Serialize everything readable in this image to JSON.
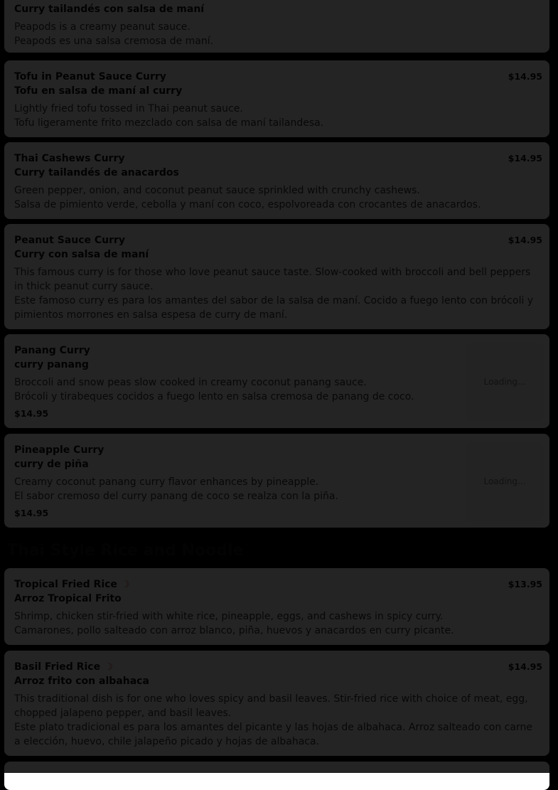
{
  "items": [
    {
      "name_es": "Curry tailandés con salsa de maní",
      "desc_en": "Peapods is a creamy peanut sauce.",
      "desc_es": "Peapods es una salsa cremosa de maní."
    },
    {
      "name_en": "Tofu in Peanut Sauce Curry",
      "name_es": "Tofu en salsa de maní al curry",
      "desc_en": "Lightly fried tofu tossed in Thai peanut sauce.",
      "desc_es": "Tofu ligeramente frito mezclado con salsa de maní tailandesa.",
      "price": "$14.95"
    },
    {
      "name_en": "Thai Cashews Curry",
      "name_es": "Curry tailandés de anacardos",
      "desc_en": "Green pepper, onion, and coconut peanut sauce sprinkled with crunchy cashews.",
      "desc_es": "Salsa de pimiento verde, cebolla y maní con coco, espolvoreada con crocantes de anacardos.",
      "price": "$14.95"
    },
    {
      "name_en": "Peanut Sauce Curry",
      "name_es": "Curry con salsa de maní",
      "desc_en": "This famous curry is for those who love peanut sauce taste. Slow-cooked with broccoli and bell peppers in thick peanut curry sauce.",
      "desc_es": "Este famoso curry es para los amantes del sabor de la salsa de maní. Cocido a fuego lento con brócoli y pimientos morrones en salsa espesa de curry de maní.",
      "price": "$14.95"
    },
    {
      "name_en": "Panang Curry",
      "name_es": "curry panang",
      "desc_en": "Broccoli and snow peas slow cooked in creamy coconut panang sauce.",
      "desc_es": "Brócoli y tirabeques cocidos a fuego lento en salsa cremosa de panang de coco.",
      "price": "$14.95",
      "image_status": "Loading..."
    },
    {
      "name_en": "Pineapple Curry",
      "name_es": "curry de piña",
      "desc_en": "Creamy coconut panang curry flavor enhances by pineapple.",
      "desc_es": "El sabor cremoso del curry panang de coco se realza con la piña.",
      "price": "$14.95",
      "image_status": "Loading..."
    },
    {
      "name_en": "Tropical Fried Rice",
      "name_es": "Arroz Tropical Frito",
      "desc_en": "Shrimp, chicken stir-fried with white rice, pineapple, eggs, and cashews in spicy curry.",
      "desc_es": "Camarones, pollo salteado con arroz blanco, piña, huevos y anacardos en curry picante.",
      "price": "$13.95",
      "spicy_icon": "chili-pepper-icon"
    },
    {
      "name_en": "Basil Fried Rice",
      "name_es": "Arroz frito con albahaca",
      "desc_en": "This traditional dish is for one who loves spicy and basil leaves. Stir-fried rice with choice of meat, egg, chopped jalapeno pepper, and basil leaves.",
      "desc_es": "Este plato tradicional es para los amantes del picante y las hojas de albahaca. Arroz salteado con carne a elección, huevo, chile jalapeño picado y hojas de albahaca.",
      "price": "$14.95",
      "spicy_icon": "chili-pepper-icon"
    }
  ],
  "sections": {
    "rice_noodle_title": "Thai Style Rice and Noodle"
  },
  "colors": {
    "overlay": "#000000",
    "card_bg": "#ffffff",
    "spicy": "#d03a2b"
  }
}
